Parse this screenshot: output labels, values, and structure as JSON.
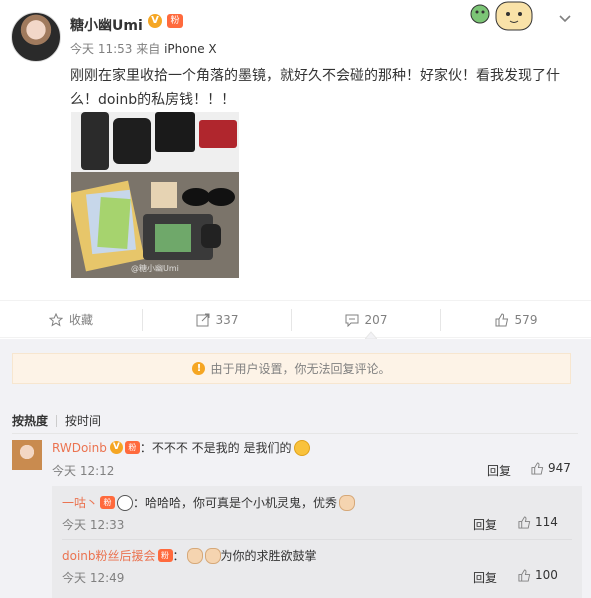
{
  "post": {
    "username": "糖小幽Umi",
    "verified_badge": "V",
    "level_badge": "粉",
    "time": "今天 11:53",
    "source_prefix": "来自",
    "device": "iPhone X",
    "text": "刚刚在家里收拾一个角落的墨镜，就好久不会碰的那种！好家伙！看我发现了什么！doinb的私房钱！！！",
    "photo_watermark": "@糖小幽Umi",
    "icons": [
      "avatar",
      "cartoon-deco-icon",
      "chevron-down-icon"
    ]
  },
  "actions": {
    "favorite_label": "收藏",
    "repost_count": "337",
    "comment_count": "207",
    "like_count": "579",
    "icons": [
      "star-icon",
      "share-icon",
      "comment-icon",
      "thumbs-up-icon"
    ]
  },
  "comments_area": {
    "notice": "由于用户设置，你无法回复评论。",
    "notice_icon": "warning-icon",
    "sort_hot": "按热度",
    "sort_time": "按时间",
    "comments": [
      {
        "name": "RWDoinb",
        "text": "：不不不 不是我的 是我们的",
        "time": "今天 12:12",
        "reply": "回复",
        "likes": "947"
      }
    ],
    "replies": [
      {
        "name": "一咕丶",
        "text": "：哈哈哈，你可真是个小机灵鬼，优秀",
        "time": "今天 12:33",
        "reply": "回复",
        "likes": "114"
      },
      {
        "name": "doinb粉丝后援会",
        "text": "为你的求胜欲鼓掌",
        "colon": "：",
        "time": "今天 12:49",
        "reply": "回复",
        "likes": "100"
      }
    ]
  },
  "colors": {
    "accent_orange": "#eb7350",
    "badge_gold": "#f5a623",
    "notice_bg": "#fdf3e7",
    "comments_bg": "#f2f2f5"
  }
}
